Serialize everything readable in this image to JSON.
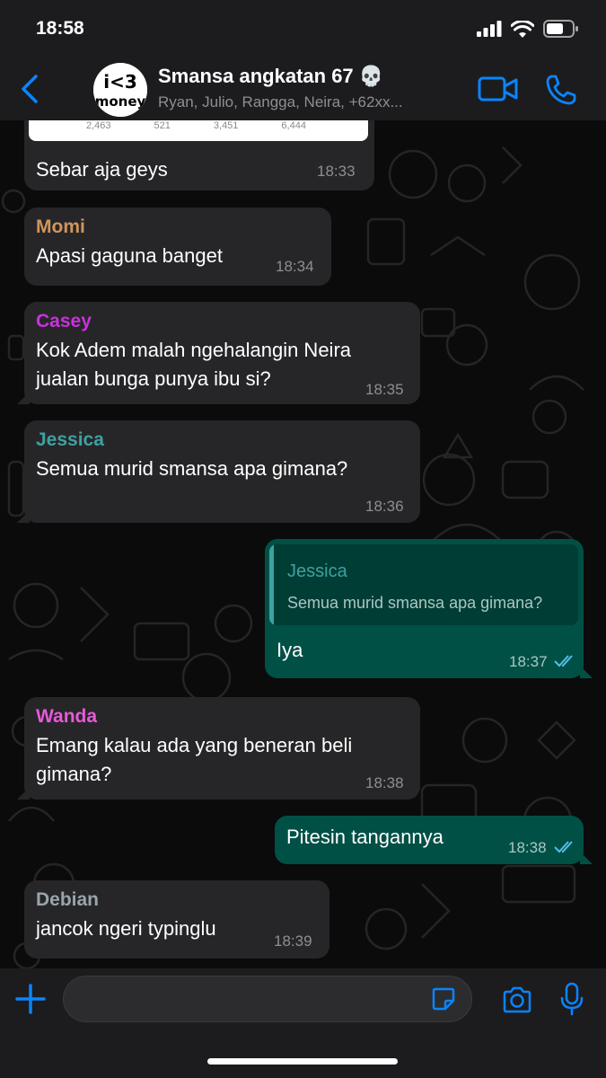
{
  "status": {
    "time": "18:58"
  },
  "header": {
    "title": "Smansa angkatan 67 💀",
    "subtitle": "Ryan, Julio, Rangga, Neira, +62xx...",
    "avatar_text_top": "i<3",
    "avatar_text_bottom": "money"
  },
  "messages": [
    {
      "type": "in",
      "text": "Sebar aja geys",
      "time": "18:33",
      "preview_stats": [
        "2,463",
        "521",
        "3,451",
        "6,444"
      ]
    },
    {
      "type": "in",
      "sender": "Momi",
      "sender_color": "#d1955b",
      "text": "Apasi gaguna banget",
      "time": "18:34"
    },
    {
      "type": "in",
      "sender": "Casey",
      "sender_color": "#cb30e0",
      "lines": [
        "Kok Adem malah ngehalangin Neira",
        "jualan bunga punya ibu si?"
      ],
      "time": "18:35"
    },
    {
      "type": "in",
      "sender": "Jessica",
      "sender_color": "#3fa1a1",
      "text": "Semua murid smansa apa gimana?",
      "time": "18:36"
    },
    {
      "type": "out",
      "quote_sender": "Jessica",
      "quote_text": "Semua murid smansa apa gimana?",
      "text": "Iya",
      "time": "18:37"
    },
    {
      "type": "in",
      "sender": "Wanda",
      "sender_color": "#e75ad8",
      "lines": [
        "Emang kalau ada yang beneran beli",
        "gimana?"
      ],
      "time": "18:38"
    },
    {
      "type": "out",
      "text": "Pitesin tangannya",
      "time": "18:38"
    },
    {
      "type": "in",
      "sender": "Debian",
      "sender_color": "#9aa4ab",
      "text": "jancok ngeri typinglu",
      "time": "18:39"
    }
  ],
  "colors": {
    "accent": "#0a84ff",
    "outgoing": "#005046",
    "incoming": "#262628",
    "read_ticks": "#53bdeb"
  }
}
